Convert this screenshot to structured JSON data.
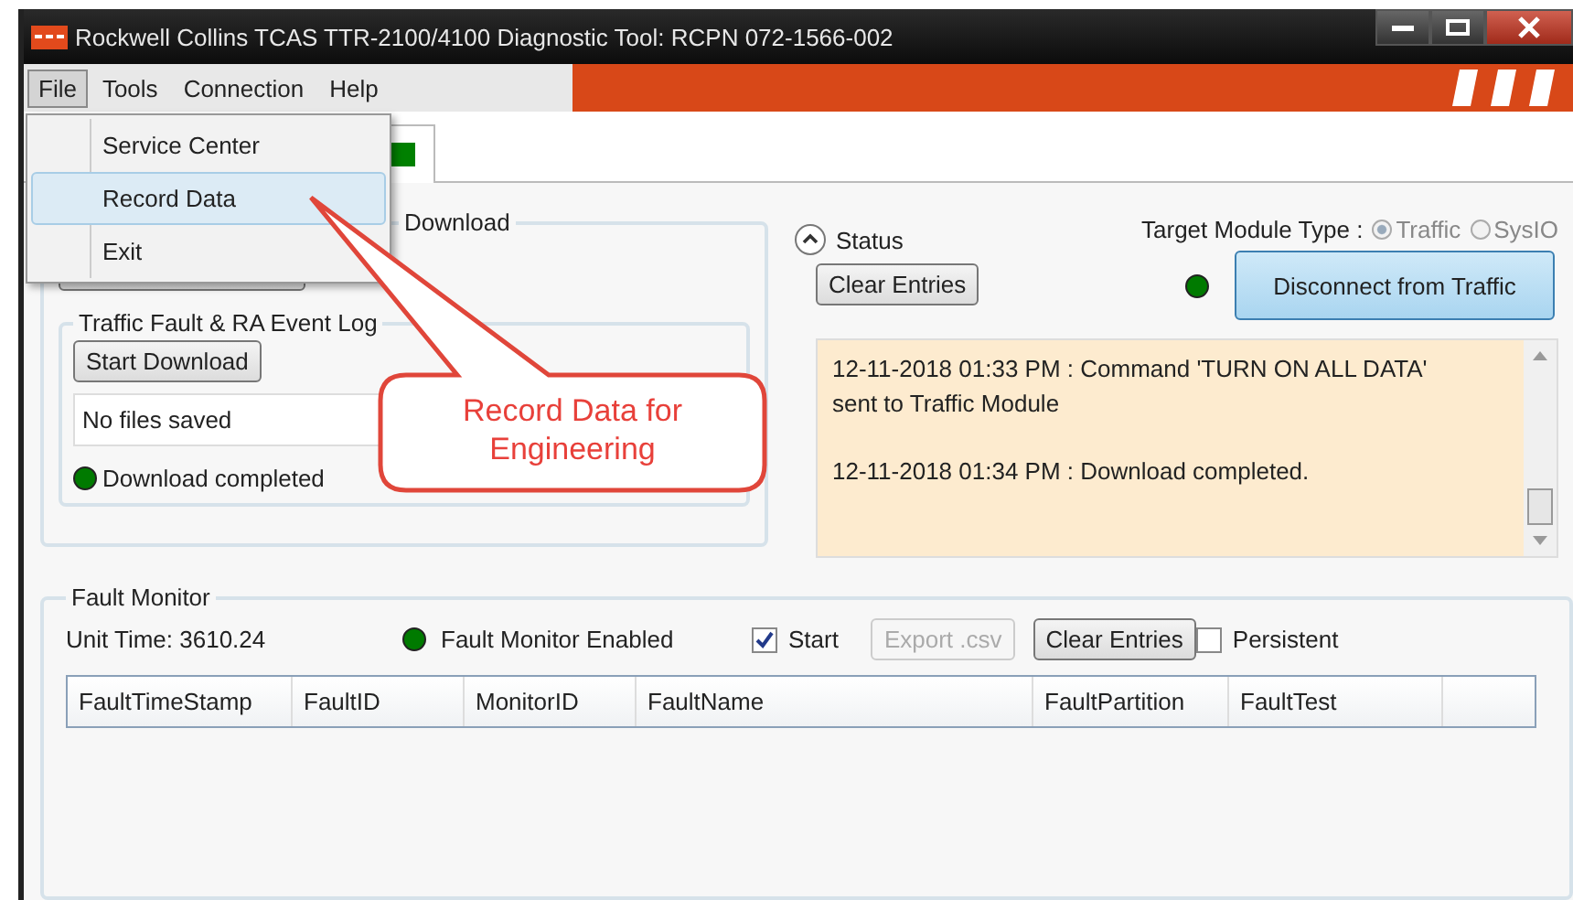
{
  "window": {
    "title": "Rockwell Collins TCAS TTR-2100/4100 Diagnostic Tool: RCPN 072-1566-002"
  },
  "menu": [
    {
      "label": "File",
      "selected": true
    },
    {
      "label": "Tools",
      "selected": false
    },
    {
      "label": "Connection",
      "selected": false
    },
    {
      "label": "Help",
      "selected": false
    }
  ],
  "file_menu": [
    {
      "label": "Service Center",
      "selected": false
    },
    {
      "label": "Record Data",
      "selected": true
    },
    {
      "label": "Exit",
      "selected": false
    }
  ],
  "download_group": {
    "title": "Download",
    "event_log": {
      "title": "Traffic Fault & RA Event Log",
      "button": "Start Download",
      "files": "No files saved",
      "status": "Download completed"
    }
  },
  "status_panel": {
    "title": "Status",
    "clear_button": "Clear Entries",
    "target_label": "Target Module Type :",
    "options": [
      {
        "label": "Traffic",
        "selected": true
      },
      {
        "label": "SysIO",
        "selected": false
      }
    ],
    "connect_button": "Disconnect from Traffic",
    "log": [
      "12-11-2018 01:33 PM : Command 'TURN ON ALL DATA' sent to Traffic Module",
      "12-11-2018 01:34 PM : Download completed."
    ]
  },
  "fault_monitor": {
    "title": "Fault Monitor",
    "unit_time": "Unit Time: 3610.24",
    "enabled_label": "Fault Monitor Enabled",
    "start": {
      "label": "Start",
      "checked": true
    },
    "export_button": {
      "label": "Export .csv",
      "disabled": true
    },
    "clear_button": "Clear Entries",
    "persistent": {
      "label": "Persistent",
      "checked": false
    },
    "columns": [
      "FaultTimeStamp",
      "FaultID",
      "MonitorID",
      "FaultName",
      "FaultPartition",
      "FaultTest"
    ]
  },
  "callout": {
    "text": "Record Data for Engineering"
  }
}
